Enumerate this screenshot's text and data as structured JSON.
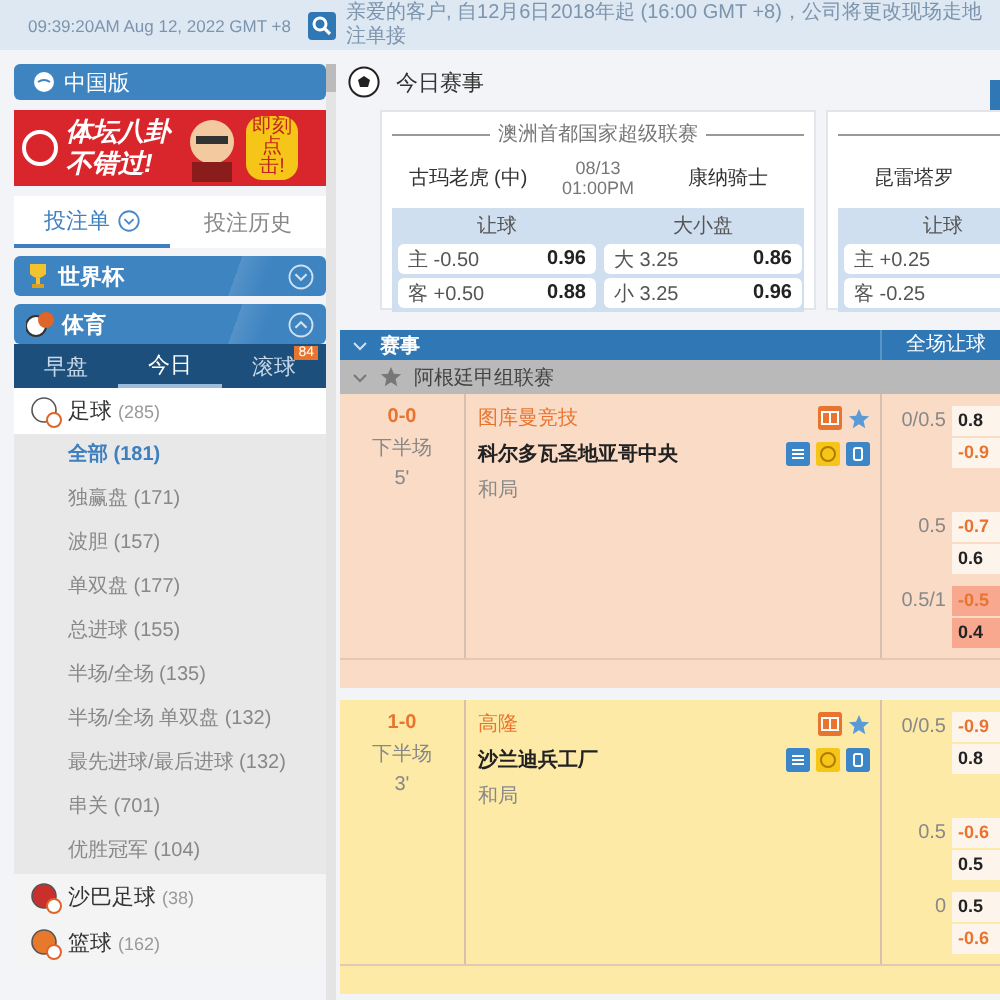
{
  "top_bar": {
    "time": "09:39:20AM Aug 12, 2022 GMT +8",
    "notice": "亲爱的客户, 自12月6日2018年起 (16:00 GMT +8)，公司将更改现场走地注单接"
  },
  "sidebar": {
    "version": "中国版",
    "banner": {
      "headline": [
        "体坛八卦",
        "不错过!"
      ],
      "badge": "即刻点击!"
    },
    "bet_tabs": [
      {
        "label": "投注单",
        "selected": true
      },
      {
        "label": "投注历史",
        "selected": false
      }
    ],
    "sections": [
      {
        "label": "世界杯",
        "expanded": false
      },
      {
        "label": "体育",
        "expanded": true
      }
    ],
    "market_tabs": [
      {
        "label": "早盘",
        "selected": false
      },
      {
        "label": "今日",
        "selected": true
      },
      {
        "label": "滚球",
        "selected": false,
        "badge": "84"
      }
    ],
    "sports": [
      {
        "name": "足球",
        "count": "(285)",
        "children": [
          {
            "label": "全部 (181)",
            "selected": true
          },
          {
            "label": "独赢盘 (171)",
            "selected": false
          },
          {
            "label": "波胆 (157)",
            "selected": false
          },
          {
            "label": "单双盘 (177)",
            "selected": false
          },
          {
            "label": "总进球 (155)",
            "selected": false
          },
          {
            "label": "半场/全场 (135)",
            "selected": false
          },
          {
            "label": "半场/全场 单双盘 (132)",
            "selected": false
          },
          {
            "label": "最先进球/最后进球 (132)",
            "selected": false
          },
          {
            "label": "串关 (701)",
            "selected": false
          },
          {
            "label": "优胜冠军 (104)",
            "selected": false
          }
        ]
      },
      {
        "name": "沙巴足球",
        "count": "(38)"
      },
      {
        "name": "篮球",
        "count": "(162)"
      }
    ]
  },
  "main": {
    "title": "今日赛事",
    "featured": [
      {
        "league": "澳洲首都国家超级联赛",
        "home": "古玛老虎 (中)",
        "date": "08/13",
        "time": "01:00PM",
        "away": "康纳骑士",
        "markets": [
          {
            "title": "让球",
            "rows": [
              {
                "label": "主 -0.50",
                "odds": "0.96",
                "negative": false
              },
              {
                "label": "客 +0.50",
                "odds": "0.88",
                "negative": false
              }
            ]
          },
          {
            "title": "大小盘",
            "rows": [
              {
                "label": "大 3.25",
                "odds": "0.86",
                "negative": false
              },
              {
                "label": "小 3.25",
                "odds": "0.96",
                "negative": false
              }
            ]
          }
        ]
      },
      {
        "home": "昆雷塔罗",
        "markets": [
          {
            "title": "让球",
            "rows": [
              {
                "label": "主 +0.25"
              },
              {
                "label": "客 -0.25"
              }
            ]
          }
        ]
      }
    ],
    "table": {
      "columns": [
        "赛事",
        "全场让球"
      ],
      "league": "阿根廷甲组联赛",
      "matches": [
        {
          "color": "#fadbc6",
          "score": "0-0",
          "period": "下半场",
          "minute": "5'",
          "home": "图库曼竞技",
          "away": "科尔多瓦圣地亚哥中央",
          "draw": "和局",
          "lines": [
            {
              "handicap": "0/0.5",
              "highlighted": false,
              "odds": [
                {
                  "value": "0.8",
                  "negative": false
                },
                {
                  "value": "-0.9",
                  "negative": true
                }
              ]
            },
            {
              "handicap": "0.5",
              "highlighted": false,
              "odds": [
                {
                  "value": "-0.7",
                  "negative": true
                },
                {
                  "value": "0.6",
                  "negative": false
                }
              ]
            },
            {
              "handicap": "0.5/1",
              "highlighted": true,
              "odds": [
                {
                  "value": "-0.5",
                  "negative": true
                },
                {
                  "value": "0.4",
                  "negative": false
                }
              ]
            }
          ]
        },
        {
          "color": "#fdeaa6",
          "score": "1-0",
          "period": "下半场",
          "minute": "3'",
          "home": "高隆",
          "away": "沙兰迪兵工厂",
          "draw": "和局",
          "lines": [
            {
              "handicap": "0/0.5",
              "highlighted": false,
              "odds": [
                {
                  "value": "-0.9",
                  "negative": true
                },
                {
                  "value": "0.8",
                  "negative": false
                }
              ]
            },
            {
              "handicap": "0.5",
              "highlighted": false,
              "odds": [
                {
                  "value": "-0.6",
                  "negative": true
                },
                {
                  "value": "0.5",
                  "negative": false
                }
              ]
            },
            {
              "handicap": "0",
              "highlighted": false,
              "odds": [
                {
                  "value": "0.5",
                  "negative": false
                },
                {
                  "value": "-0.6",
                  "negative": true
                }
              ]
            }
          ]
        }
      ]
    }
  }
}
